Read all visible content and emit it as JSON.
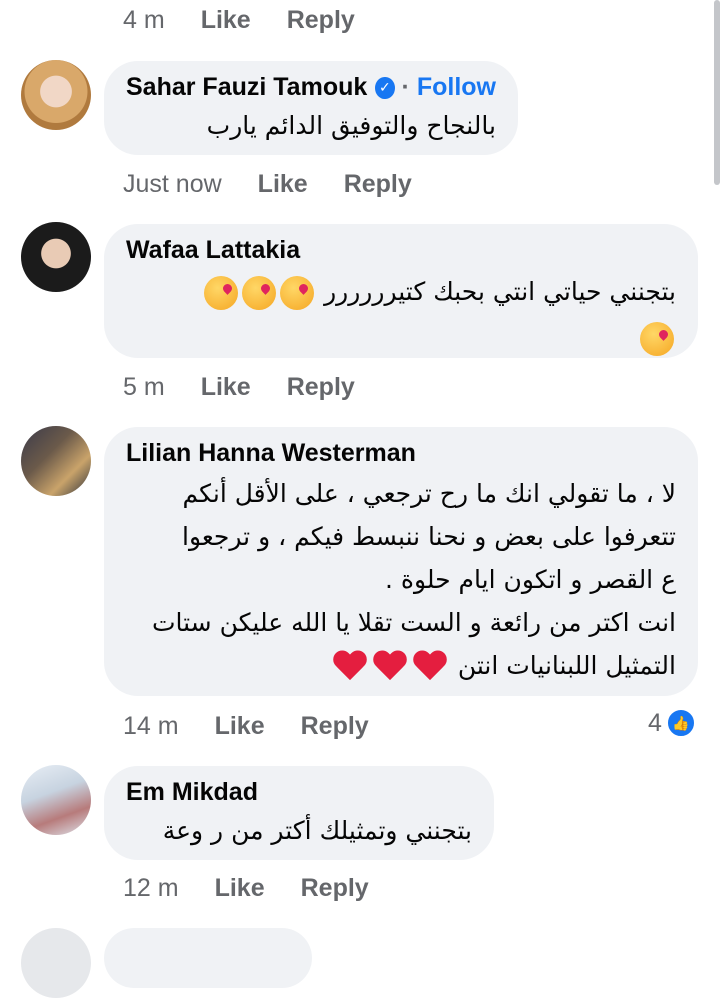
{
  "comments": [
    {
      "name": "",
      "time": "4 m",
      "like": "Like",
      "reply": "Reply"
    },
    {
      "name": "Sahar Fauzi Tamouk",
      "follow": "Follow",
      "dot": "·",
      "text_lines": [
        "بالنجاح والتوفيق الدائم يارب"
      ],
      "time": "Just now",
      "like": "Like",
      "reply": "Reply"
    },
    {
      "name": "Wafaa Lattakia",
      "text_lines": [
        "بتجنني حياتي انتي بحبك كتيرررررر"
      ],
      "time": "5 m",
      "like": "Like",
      "reply": "Reply"
    },
    {
      "name": "Lilian Hanna Westerman",
      "text_lines": [
        "لا ، ما تقولي انك ما رح ترجعي ، على الأقل أنكم",
        "تتعرفوا على بعض و نحنا ننبسط فيكم ، و ترجعوا",
        "ع القصر و اتكون ايام حلوة .",
        "انت اكتر من رائعة و الست تقلا يا الله عليكن ستات",
        "التمثيل اللبنانيات انتن"
      ],
      "time": "14 m",
      "like": "Like",
      "reply": "Reply",
      "reaction_count": "4"
    },
    {
      "name": "Em Mikdad",
      "text_lines": [
        "بتجنني وتمثيلك أكتر من ر وعة"
      ],
      "time": "12 m",
      "like": "Like",
      "reply": "Reply"
    }
  ],
  "colors": {
    "bubble": "#f0f2f5",
    "meta": "#65676b",
    "link": "#1877f2"
  },
  "icons": [
    "verified-icon",
    "kiss-emoji-icon",
    "heart-emoji-icon",
    "like-reaction-icon"
  ]
}
